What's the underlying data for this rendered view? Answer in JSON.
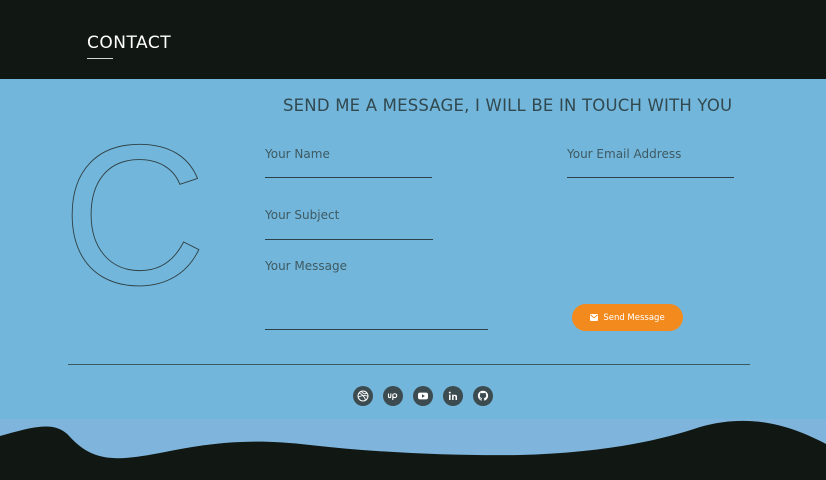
{
  "section": {
    "title": "CONTACT"
  },
  "hero": {
    "letter": "C"
  },
  "form": {
    "headline": "SEND ME A MESSAGE, I WILL BE IN TOUCH WITH YOU",
    "name_label": "Your Name",
    "email_label": "Your Email Address",
    "subject_label": "Your Subject",
    "message_label": "Your Message",
    "submit_label": "Send Message"
  },
  "socials": [
    {
      "icon": "dribbble-icon"
    },
    {
      "icon": "upwork-icon"
    },
    {
      "icon": "youtube-icon"
    },
    {
      "icon": "linkedin-icon"
    },
    {
      "icon": "github-icon"
    }
  ],
  "colors": {
    "background": "#72b7db",
    "dark": "#111813",
    "accent": "#f38a1d",
    "footer_band": "#7fb4dc"
  }
}
